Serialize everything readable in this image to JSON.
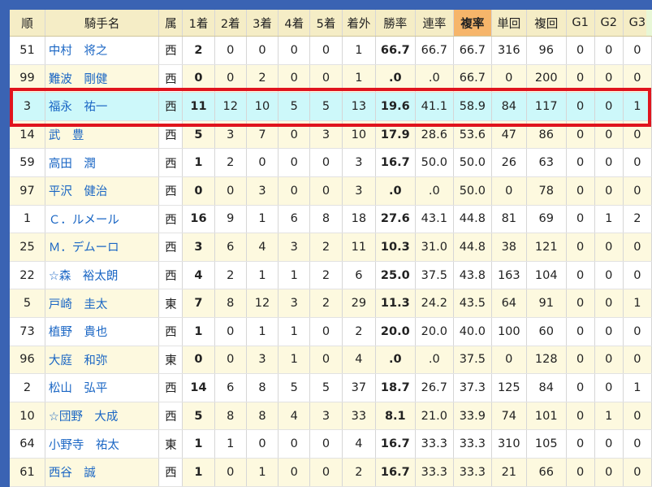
{
  "headers": [
    "順",
    "騎手名",
    "属",
    "1着",
    "2着",
    "3着",
    "4着",
    "5着",
    "着外",
    "勝率",
    "連率",
    "複率",
    "単回",
    "複回",
    "G1",
    "G2",
    "G3"
  ],
  "rows": [
    [
      "51",
      "中村　将之",
      "西",
      "2",
      "0",
      "0",
      "0",
      "0",
      "1",
      "66.7",
      "66.7",
      "66.7",
      "316",
      "96",
      "0",
      "0",
      "0"
    ],
    [
      "99",
      "難波　剛健",
      "西",
      "0",
      "0",
      "2",
      "0",
      "0",
      "1",
      ".0",
      ".0",
      "66.7",
      "0",
      "200",
      "0",
      "0",
      "0"
    ],
    [
      "3",
      "福永　祐一",
      "西",
      "11",
      "12",
      "10",
      "5",
      "5",
      "13",
      "19.6",
      "41.1",
      "58.9",
      "84",
      "117",
      "0",
      "0",
      "1"
    ],
    [
      "14",
      "武　豊",
      "西",
      "5",
      "3",
      "7",
      "0",
      "3",
      "10",
      "17.9",
      "28.6",
      "53.6",
      "47",
      "86",
      "0",
      "0",
      "0"
    ],
    [
      "59",
      "高田　潤",
      "西",
      "1",
      "2",
      "0",
      "0",
      "0",
      "3",
      "16.7",
      "50.0",
      "50.0",
      "26",
      "63",
      "0",
      "0",
      "0"
    ],
    [
      "97",
      "平沢　健治",
      "西",
      "0",
      "0",
      "3",
      "0",
      "0",
      "3",
      ".0",
      ".0",
      "50.0",
      "0",
      "78",
      "0",
      "0",
      "0"
    ],
    [
      "1",
      "Ｃ．ルメール",
      "西",
      "16",
      "9",
      "1",
      "6",
      "8",
      "18",
      "27.6",
      "43.1",
      "44.8",
      "81",
      "69",
      "0",
      "1",
      "2"
    ],
    [
      "25",
      "Ｍ．デムーロ",
      "西",
      "3",
      "6",
      "4",
      "3",
      "2",
      "11",
      "10.3",
      "31.0",
      "44.8",
      "38",
      "121",
      "0",
      "0",
      "0"
    ],
    [
      "22",
      "☆森　裕太朗",
      "西",
      "4",
      "2",
      "1",
      "1",
      "2",
      "6",
      "25.0",
      "37.5",
      "43.8",
      "163",
      "104",
      "0",
      "0",
      "0"
    ],
    [
      "5",
      "戸崎　圭太",
      "東",
      "7",
      "8",
      "12",
      "3",
      "2",
      "29",
      "11.3",
      "24.2",
      "43.5",
      "64",
      "91",
      "0",
      "0",
      "1"
    ],
    [
      "73",
      "植野　貴也",
      "西",
      "1",
      "0",
      "1",
      "1",
      "0",
      "2",
      "20.0",
      "20.0",
      "40.0",
      "100",
      "60",
      "0",
      "0",
      "0"
    ],
    [
      "96",
      "大庭　和弥",
      "東",
      "0",
      "0",
      "3",
      "1",
      "0",
      "4",
      ".0",
      ".0",
      "37.5",
      "0",
      "128",
      "0",
      "0",
      "0"
    ],
    [
      "2",
      "松山　弘平",
      "西",
      "14",
      "6",
      "8",
      "5",
      "5",
      "37",
      "18.7",
      "26.7",
      "37.3",
      "125",
      "84",
      "0",
      "0",
      "1"
    ],
    [
      "10",
      "☆団野　大成",
      "西",
      "5",
      "8",
      "8",
      "4",
      "3",
      "33",
      "8.1",
      "21.0",
      "33.9",
      "74",
      "101",
      "0",
      "1",
      "0"
    ],
    [
      "64",
      "小野寺　祐太",
      "東",
      "1",
      "1",
      "0",
      "0",
      "0",
      "4",
      "16.7",
      "33.3",
      "33.3",
      "310",
      "105",
      "0",
      "0",
      "0"
    ],
    [
      "61",
      "西谷　誠",
      "西",
      "1",
      "0",
      "1",
      "0",
      "0",
      "2",
      "16.7",
      "33.3",
      "33.3",
      "21",
      "66",
      "0",
      "0",
      "0"
    ]
  ],
  "highlight_row": 2,
  "sort_column": "複率",
  "colors": {
    "background": "#3a63b3",
    "header": "#f5edc6",
    "sort_header": "#f6b56a",
    "highlight": "#cdf8fa",
    "highlight_border": "#e0141e",
    "name_link": "#1a66c4"
  }
}
